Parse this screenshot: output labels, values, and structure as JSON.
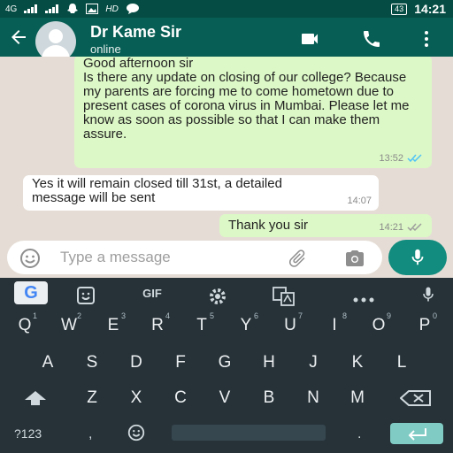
{
  "status_bar": {
    "network": "4G",
    "hd": "HD",
    "battery": "43",
    "time": "14:21"
  },
  "header": {
    "contact_name": "Dr Kame Sir",
    "contact_status": "online",
    "icons": [
      "back-arrow-icon",
      "avatar",
      "video-call-icon",
      "phone-icon",
      "more-vert-icon"
    ]
  },
  "messages": [
    {
      "direction": "outgoing",
      "text": "Good afternoon sir\nIs there any update on closing of our college? Because my parents are forcing me to come hometown due to present cases of corona virus in Mumbai. Please let me know as soon as possible so that I can make them assure.",
      "time": "13:52",
      "read": true
    },
    {
      "direction": "incoming",
      "text": "Yes it will remain closed till 31st, a detailed message will be sent",
      "time": "14:07"
    },
    {
      "direction": "outgoing",
      "text": "Thank you sir",
      "time": "14:21",
      "read": false
    }
  ],
  "composer": {
    "placeholder": "Type a message"
  },
  "keyboard": {
    "toolbar": [
      "G",
      "sticker-icon",
      "GIF",
      "settings-icon",
      "translate-icon",
      "more-icon",
      "mic-icon"
    ],
    "gif_label": "GIF",
    "row1": [
      "Q",
      "W",
      "E",
      "R",
      "T",
      "Y",
      "U",
      "I",
      "O",
      "P"
    ],
    "row1_hints": [
      "1",
      "2",
      "3",
      "4",
      "5",
      "6",
      "7",
      "8",
      "9",
      "0"
    ],
    "row2": [
      "A",
      "S",
      "D",
      "F",
      "G",
      "H",
      "J",
      "K",
      "L"
    ],
    "row3": [
      "Z",
      "X",
      "C",
      "V",
      "B",
      "N",
      "M"
    ],
    "symbols_key": "?123",
    "comma_key": ",",
    "period_key": "."
  }
}
